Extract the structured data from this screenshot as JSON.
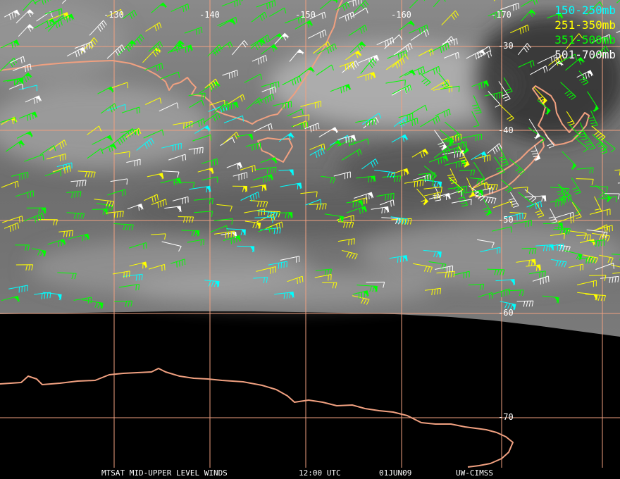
{
  "colors": {
    "grid": "#f0a080",
    "coast": "#f0a080",
    "level_150_250": "#00ffff",
    "level_251_350": "#ffff00",
    "level_351_500": "#00ff00",
    "level_501_700": "#ffffff"
  },
  "grid": {
    "longitude_labels": [
      "-130",
      "-140",
      "-150",
      "-160",
      "-170"
    ],
    "latitude_labels": [
      "-30",
      "-40",
      "-50",
      "-60",
      "-70"
    ]
  },
  "legend": [
    {
      "label": "150-250mb",
      "color": "#00ffff"
    },
    {
      "label": "251-350mb",
      "color": "#ffff00"
    },
    {
      "label": "351-500mb",
      "color": "#00ff00"
    },
    {
      "label": "501-700mb",
      "color": "#ffffff"
    }
  ],
  "caption": {
    "product": "MTSAT MID-UPPER LEVEL WINDS",
    "time": "12:00 UTC",
    "date": "01JUN09",
    "source": "UW-CIMSS"
  }
}
